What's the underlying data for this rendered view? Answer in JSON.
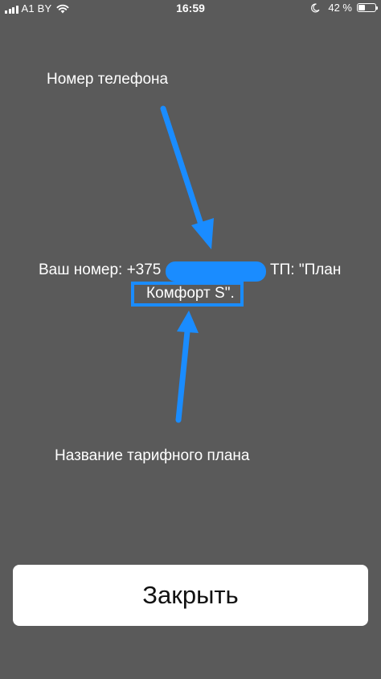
{
  "status_bar": {
    "carrier": "A1 BY",
    "time": "16:59",
    "battery_percent": "42 %",
    "battery_level": 0.42,
    "icons": [
      "signal-icon",
      "wifi-icon",
      "moon-icon",
      "battery-icon"
    ]
  },
  "annotations": {
    "phone_label": "Номер телефона",
    "plan_label": "Название тарифного плана",
    "accent_color": "#1a8cff"
  },
  "message": {
    "prefix": "Ваш номер: +375",
    "suffix": "ТП: \"План",
    "plan_name": "Комфорт S\"."
  },
  "close_button": {
    "label": "Закрыть"
  },
  "colors": {
    "background": "#5a5a5a",
    "accent": "#1a8cff",
    "button_bg": "#ffffff"
  }
}
